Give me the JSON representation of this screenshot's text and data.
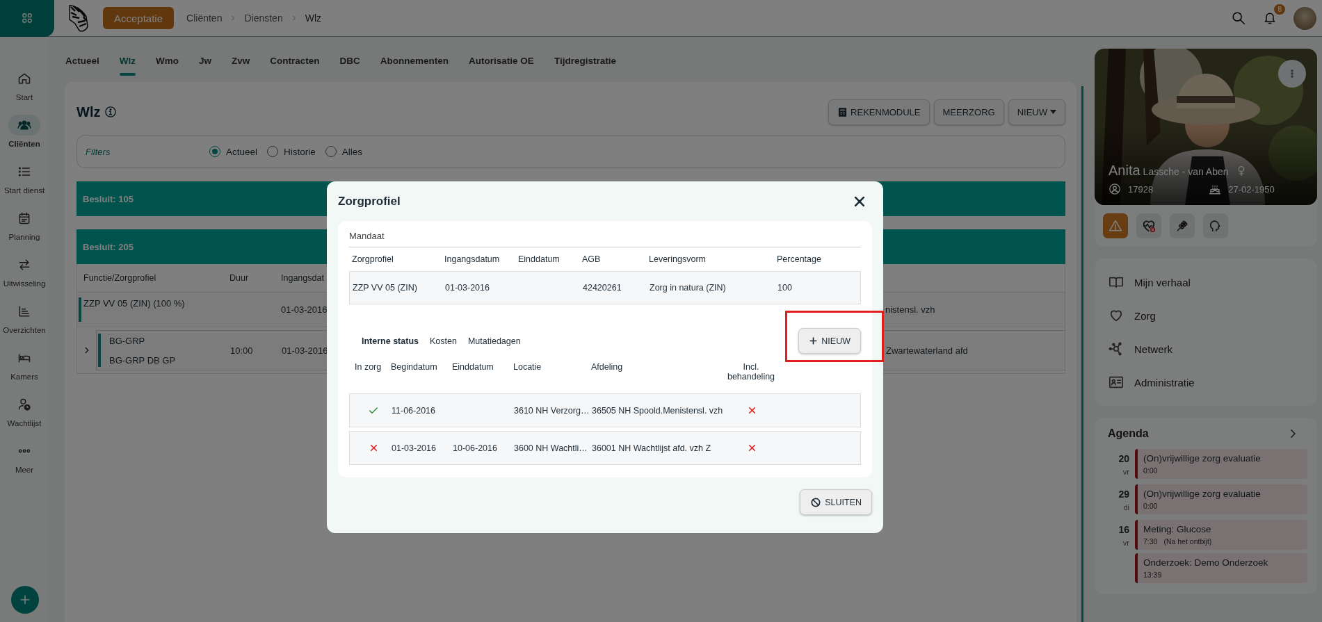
{
  "topbar": {
    "acceptatie": "Acceptatie",
    "breadcrumb": [
      "Cliënten",
      "Diensten",
      "Wlz"
    ],
    "notifications": "8"
  },
  "rail": {
    "items": [
      {
        "label": "Start",
        "kind": "home",
        "selected": false
      },
      {
        "label": "Cliënten",
        "kind": "people",
        "selected": true
      },
      {
        "label": "Start dienst",
        "kind": "list",
        "selected": false
      },
      {
        "label": "Planning",
        "kind": "calendar",
        "selected": false
      },
      {
        "label": "Uitwisseling",
        "kind": "exchange",
        "selected": false
      },
      {
        "label": "Overzichten",
        "kind": "chart",
        "selected": false
      },
      {
        "label": "Kamers",
        "kind": "bed",
        "selected": false
      },
      {
        "label": "Wachtlijst",
        "kind": "waitlist",
        "selected": false
      },
      {
        "label": "Meer",
        "kind": "more",
        "selected": false
      }
    ]
  },
  "tabs": [
    {
      "label": "Actueel",
      "selected": false
    },
    {
      "label": "Wlz",
      "selected": true
    },
    {
      "label": "Wmo",
      "selected": false
    },
    {
      "label": "Jw",
      "selected": false
    },
    {
      "label": "Zvw",
      "selected": false
    },
    {
      "label": "Contracten",
      "selected": false
    },
    {
      "label": "DBC",
      "selected": false
    },
    {
      "label": "Abonnementen",
      "selected": false
    },
    {
      "label": "Autorisatie OE",
      "selected": false
    },
    {
      "label": "Tijdregistratie",
      "selected": false
    }
  ],
  "wlz": {
    "title": "Wlz",
    "buttons": [
      {
        "label": "REKENMODULE",
        "kind": "calculator"
      },
      {
        "label": "MEERZORG",
        "kind": "plain"
      },
      {
        "label": "NIEUW",
        "kind": "dropdown"
      }
    ],
    "filters": {
      "label": "Filters",
      "options": [
        {
          "label": "Actueel",
          "selected": true
        },
        {
          "label": "Historie",
          "selected": false
        },
        {
          "label": "Alles",
          "selected": false
        }
      ]
    },
    "besluiten": [
      {
        "title": "Besluit: 105"
      },
      {
        "title": "Besluit: 205",
        "columns": [
          "Functie/Zorgprofiel",
          "Duur",
          "Ingangsdat"
        ],
        "rows": [
          {
            "kind": "profile",
            "lines": [
              "ZZP VV 05 (ZIN) (100 %)"
            ],
            "datum": "01-03-2016",
            "column_4": "nistensl. vzh"
          },
          {
            "kind": "function",
            "lines": [
              "BG-GRP",
              "BG-GRP DB GP"
            ],
            "duur": "10:00",
            "datum": "01-03-2016",
            "column_4": "Zwartewaterland afd"
          }
        ]
      }
    ]
  },
  "client": {
    "first_name": "Anita",
    "last_name": "Lassche - van Aben",
    "number": "17928",
    "birth_date": "27-02-1950",
    "alerts": [
      {
        "kind": "warning",
        "active": true
      },
      {
        "kind": "heart",
        "active": false
      },
      {
        "kind": "wheat",
        "active": false
      },
      {
        "kind": "head",
        "active": false
      }
    ],
    "menu": [
      {
        "label": "Mijn verhaal",
        "kind": "book"
      },
      {
        "label": "Zorg",
        "kind": "heart"
      },
      {
        "label": "Netwerk",
        "kind": "network"
      },
      {
        "label": "Administratie",
        "kind": "card"
      }
    ]
  },
  "agenda": {
    "title": "Agenda",
    "days": [
      {
        "day": "20",
        "weekday": "vr",
        "events": [
          {
            "title": "(On)vrijwillige zorg evaluatie",
            "time": "0:00"
          }
        ]
      },
      {
        "day": "29",
        "weekday": "di",
        "events": [
          {
            "title": "(On)vrijwillige zorg evaluatie",
            "time": "0:00"
          }
        ]
      },
      {
        "day": "16",
        "weekday": "vr",
        "events": [
          {
            "title": "Meting: Glucose",
            "time": "7:30",
            "note": "(Na het ontbijt)"
          },
          {
            "title": "Onderzoek: Demo Onderzoek",
            "time": "13:39"
          }
        ]
      }
    ]
  },
  "modal": {
    "title": "Zorgprofiel",
    "mandaat": {
      "label": "Mandaat",
      "columns": [
        "Zorgprofiel",
        "Ingangsdatum",
        "Einddatum",
        "AGB",
        "Leveringsvorm",
        "Percentage"
      ],
      "row": {
        "zorgprofiel": "ZZP VV 05 (ZIN)",
        "ingangsdatum": "01-03-2016",
        "agb": "42420261",
        "leveringsvorm": "Zorg in natura (ZIN)",
        "percentage": "100"
      }
    },
    "tabs": [
      {
        "label": "Interne status",
        "selected": true
      },
      {
        "label": "Kosten",
        "selected": false
      },
      {
        "label": "Mutatiedagen",
        "selected": false
      }
    ],
    "new_button": {
      "label": "NIEUW",
      "highlighted": true
    },
    "status_columns": [
      "In zorg",
      "Begindatum",
      "Einddatum",
      "Locatie",
      "Afdeling",
      "Incl. behandeling"
    ],
    "status_rows": [
      {
        "in_zorg": true,
        "begin": "11-06-2016",
        "locatie": "3610 NH Verzorg…",
        "afdeling": "36505 NH Spoold.Menistensl. vzh",
        "incl_behandeling": false
      },
      {
        "in_zorg": false,
        "begin": "01-03-2016",
        "eind": "10-06-2016",
        "locatie": "3600 NH Wachtli…",
        "afdeling": "36001 NH Wachtlijst afd. vzh Z",
        "incl_behandeling": false
      }
    ],
    "close_button": "SLUITEN"
  }
}
